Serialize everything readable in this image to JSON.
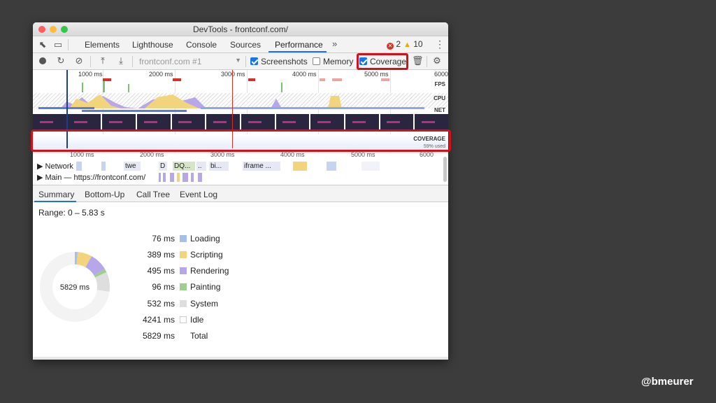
{
  "window": {
    "title": "DevTools - frontconf.com/"
  },
  "tabs": [
    {
      "label": "Elements"
    },
    {
      "label": "Lighthouse"
    },
    {
      "label": "Console"
    },
    {
      "label": "Sources"
    },
    {
      "label": "Performance",
      "active": true
    }
  ],
  "status": {
    "errors": "2",
    "warnings": "10",
    "more_tabs": "»"
  },
  "toolbar": {
    "profile": "frontconf.com #1",
    "screenshots_label": "Screenshots",
    "screenshots_checked": true,
    "memory_label": "Memory",
    "memory_checked": false,
    "coverage_label": "Coverage",
    "coverage_checked": true
  },
  "overview": {
    "ruler": [
      "1000 ms",
      "2000 ms",
      "3000 ms",
      "4000 ms",
      "5000 ms",
      "6000"
    ],
    "tracks": {
      "fps": "FPS",
      "cpu": "CPU",
      "net": "NET",
      "coverage": "COVERAGE",
      "coverage_used": "59% used"
    }
  },
  "flame": {
    "ruler": [
      "1000 ms",
      "2000 ms",
      "3000 ms",
      "4000 ms",
      "5000 ms",
      "6000"
    ],
    "network_label": "Network",
    "network_items": [
      "twe",
      "D",
      "DQ...",
      "..",
      "bi...",
      "iframe ..."
    ],
    "main_label": "Main — https://frontconf.com/"
  },
  "bottom_tabs": [
    "Summary",
    "Bottom-Up",
    "Call Tree",
    "Event Log"
  ],
  "summary": {
    "range": "Range: 0 – 5.83 s",
    "total_center": "5829 ms",
    "rows": [
      {
        "value": "76 ms",
        "name": "Loading",
        "color": "#a4bfe8"
      },
      {
        "value": "389 ms",
        "name": "Scripting",
        "color": "#f2d47c"
      },
      {
        "value": "495 ms",
        "name": "Rendering",
        "color": "#b7a6ea"
      },
      {
        "value": "96 ms",
        "name": "Painting",
        "color": "#9fcf8c"
      },
      {
        "value": "532 ms",
        "name": "System",
        "color": "#dedede"
      },
      {
        "value": "4241 ms",
        "name": "Idle",
        "color": "#ffffff"
      },
      {
        "value": "5829 ms",
        "name": "Total",
        "color": ""
      }
    ]
  },
  "handle": "@bmeurer"
}
